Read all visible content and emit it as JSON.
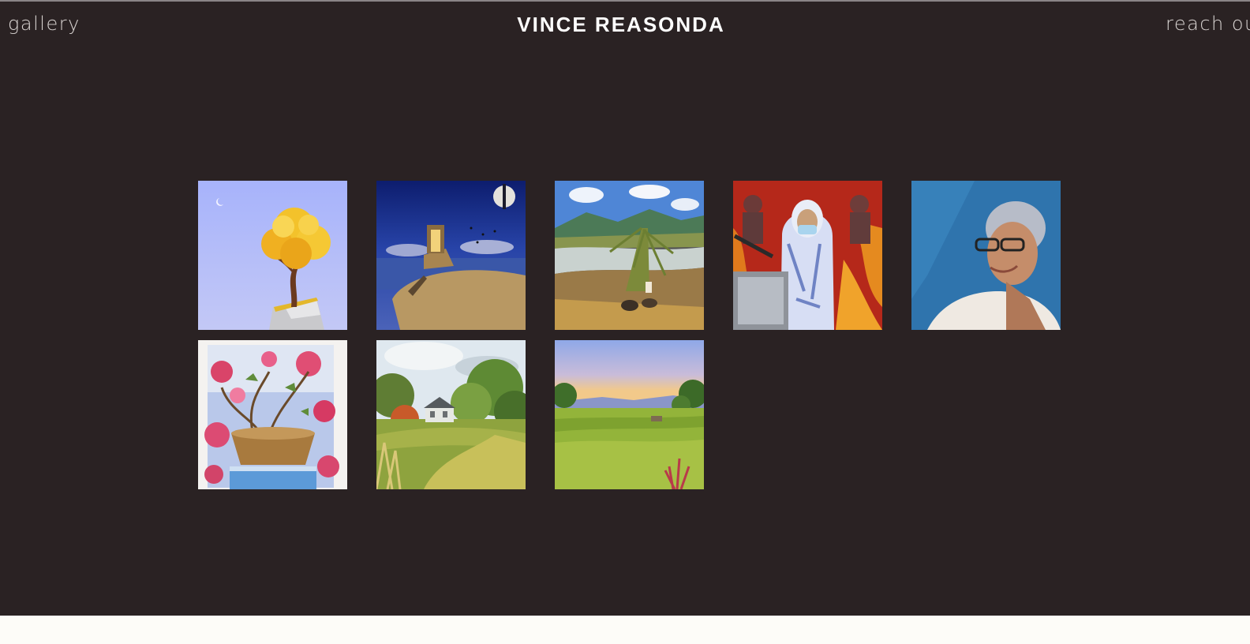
{
  "header": {
    "nav_left_label": "gallery",
    "site_title": "VINCE REASONDA",
    "nav_right_label": "reach out"
  },
  "gallery": {
    "artworks": [
      {
        "subject": "golden-tree-on-rock-painting"
      },
      {
        "subject": "surreal-doorway-shore-painting"
      },
      {
        "subject": "riverbank-fisherman-painting"
      },
      {
        "subject": "health-worker-in-ppe-painting"
      },
      {
        "subject": "elderly-woman-portrait-painting"
      },
      {
        "subject": "bougainvillea-pot-painting"
      },
      {
        "subject": "house-in-field-painting"
      },
      {
        "subject": "rice-field-sunset-painting"
      }
    ]
  },
  "colors": {
    "page_background": "#2a2223",
    "footer_background": "#fdfcf8",
    "title_color": "#ffffff",
    "nav_color": "#d9d4d2"
  }
}
